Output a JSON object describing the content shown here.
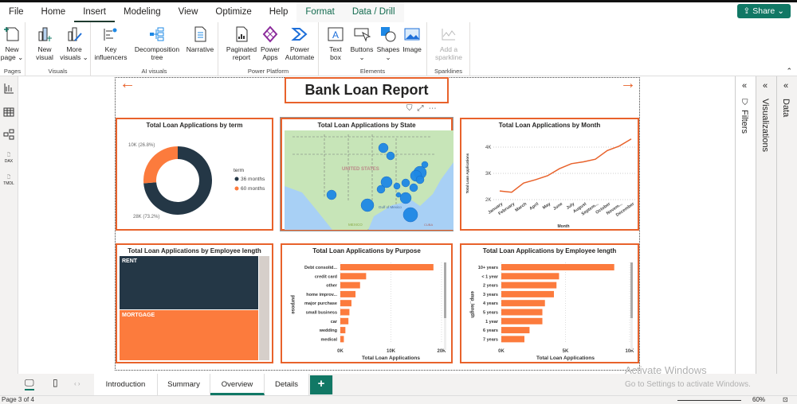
{
  "menu": {
    "tabs": [
      "File",
      "Home",
      "Insert",
      "Modeling",
      "View",
      "Optimize",
      "Help",
      "Format",
      "Data / Drill"
    ],
    "active": "Insert",
    "share": "Share"
  },
  "ribbon": {
    "groups": [
      {
        "label": "Pages",
        "buttons": [
          "New page"
        ]
      },
      {
        "label": "Visuals",
        "buttons": [
          "New visual",
          "More visuals"
        ]
      },
      {
        "label": "AI visuals",
        "buttons": [
          "Key influencers",
          "Decomposition tree",
          "Narrative"
        ]
      },
      {
        "label": "Power Platform",
        "buttons": [
          "Paginated report",
          "Power Apps",
          "Power Automate"
        ]
      },
      {
        "label": "Elements",
        "buttons": [
          "Text box",
          "Buttons",
          "Shapes",
          "Image"
        ]
      },
      {
        "label": "Sparklines",
        "buttons": [
          "Add a sparkline"
        ]
      }
    ]
  },
  "left_rail": {
    "icons": [
      "report-view-icon",
      "table-view-icon",
      "model-view-icon",
      "dax-query-icon",
      "tmdl-view-icon"
    ],
    "dax": "DAX",
    "tmdl": "TMDL"
  },
  "report": {
    "title": "Bank Loan Report"
  },
  "panes": {
    "filters": "Filters",
    "visualizations": "Visualizations",
    "data": "Data"
  },
  "pages": {
    "tabs": [
      "Introduction",
      "Summary",
      "Overview",
      "Details"
    ],
    "active": "Overview",
    "add": "+"
  },
  "status": {
    "page": "Page 3 of 4",
    "zoom": "60%"
  },
  "watermark": {
    "line1": "Activate Windows",
    "line2": "Go to Settings to activate Windows."
  },
  "colors": {
    "accent": "#e8622b",
    "dark": "#243746",
    "orange": "#fc7b3d",
    "bubble": "#1e88e5",
    "teal": "#117865"
  },
  "chart_data": [
    {
      "type": "pie",
      "variant": "donut",
      "title": "Total Loan Applications by term",
      "legend_title": "term",
      "legend": "right",
      "series": [
        {
          "name": "36 months",
          "value": 28000,
          "label": "28K (73.2%)",
          "color": "#243746"
        },
        {
          "name": "60 months",
          "value": 10000,
          "label": "10K (26.8%)",
          "color": "#fc7b3d"
        }
      ]
    },
    {
      "type": "map",
      "title": "Total Loan Applications by State",
      "labels": [
        "UNITED STATES",
        "Gulf of Mexico",
        "MEXICO",
        "CUBA"
      ]
    },
    {
      "type": "line",
      "title": "Total Loan Applications by Month",
      "xlabel": "Month",
      "ylabel": "Total Loan Applications",
      "categories": [
        "January",
        "February",
        "March",
        "April",
        "May",
        "June",
        "July",
        "August",
        "Septem...",
        "October",
        "Novem...",
        "December"
      ],
      "values": [
        2330,
        2280,
        2630,
        2760,
        2910,
        3180,
        3370,
        3440,
        3540,
        3870,
        4040,
        4310
      ],
      "yticks": [
        "2K",
        "3K",
        "4K"
      ],
      "ylim": [
        2000,
        4000
      ],
      "grid": true
    },
    {
      "type": "treemap",
      "title": "Total Loan Applications by Employee length",
      "categories": [
        "RENT",
        "MORTGAGE"
      ]
    },
    {
      "type": "bar",
      "orientation": "horizontal",
      "title": "Total Loan Applications by Purpose",
      "xlabel": "Total Loan Applications",
      "ylabel": "purpose",
      "categories": [
        "Debt consolid...",
        "credit card",
        "other",
        "home improv...",
        "major purchase",
        "small business",
        "car",
        "wedding",
        "medical"
      ],
      "values": [
        18400,
        5100,
        3900,
        3000,
        2200,
        1800,
        1600,
        1000,
        700
      ],
      "xticks": [
        "0K",
        "10K",
        "20K"
      ],
      "xlim": [
        0,
        20000
      ],
      "grid": true
    },
    {
      "type": "bar",
      "orientation": "horizontal",
      "title": "Total Loan Applications by Employee length",
      "xlabel": "Total Loan Applications",
      "ylabel": "emp_length",
      "categories": [
        "10+ years",
        "< 1 year",
        "2 years",
        "3 years",
        "4 years",
        "5 years",
        "1 year",
        "6 years",
        "7 years"
      ],
      "values": [
        8800,
        4500,
        4300,
        4100,
        3400,
        3200,
        3200,
        2200,
        1800
      ],
      "xticks": [
        "0K",
        "5K",
        "10K"
      ],
      "xlim": [
        0,
        10000
      ],
      "grid": true
    }
  ]
}
